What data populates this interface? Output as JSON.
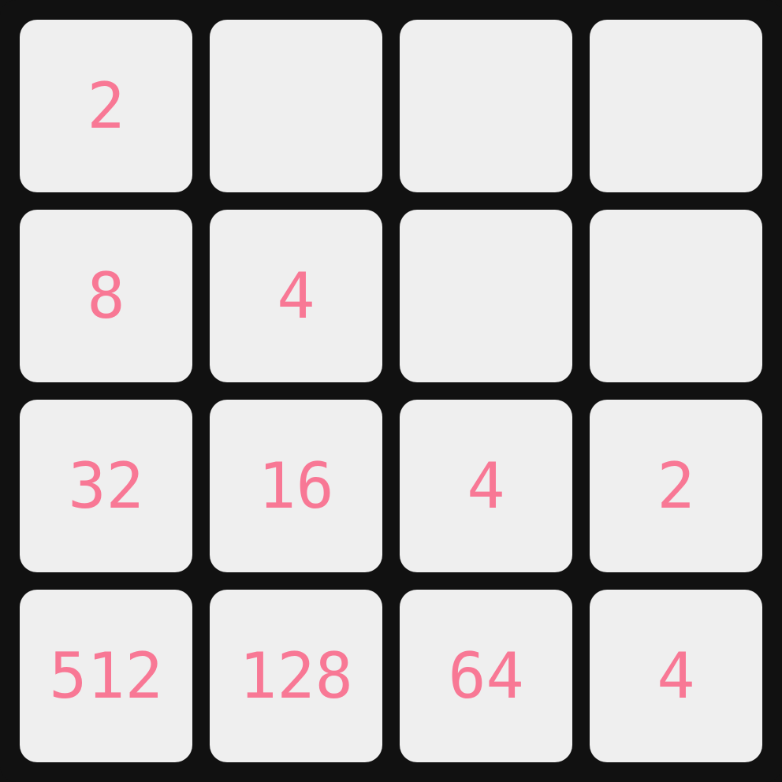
{
  "board": {
    "tiles": [
      [
        "2",
        "",
        "",
        ""
      ],
      [
        "8",
        "4",
        "",
        ""
      ],
      [
        "32",
        "16",
        "4",
        "2"
      ],
      [
        "512",
        "128",
        "64",
        "4"
      ]
    ]
  },
  "colors": {
    "background": "#111111",
    "tile": "#efefef",
    "number": "#f87895"
  }
}
